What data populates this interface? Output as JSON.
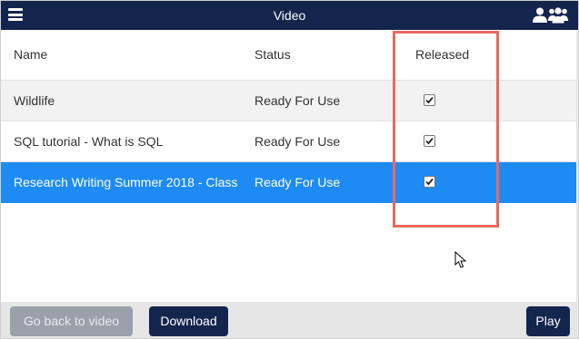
{
  "titlebar": {
    "title": "Video",
    "menu_icon": "hamburger-menu-icon",
    "users_icon": "users-group-icon",
    "bg_color": "#14254d"
  },
  "table": {
    "headers": {
      "name": "Name",
      "status": "Status",
      "released": "Released"
    },
    "rows": [
      {
        "name": "Wildlife",
        "status": "Ready For Use",
        "released": true
      },
      {
        "name": "SQL tutorial - What is SQL",
        "status": "Ready For Use",
        "released": true
      },
      {
        "name": "Research Writing Summer 2018 - Class",
        "status": "Ready For Use",
        "released": true
      }
    ],
    "selected_row": 2,
    "selected_color": "#1e8bf5"
  },
  "annotation": {
    "highlight_color": "#e8695e"
  },
  "footer": {
    "back_label": "Go back to video",
    "download_label": "Download",
    "play_label": "Play"
  }
}
